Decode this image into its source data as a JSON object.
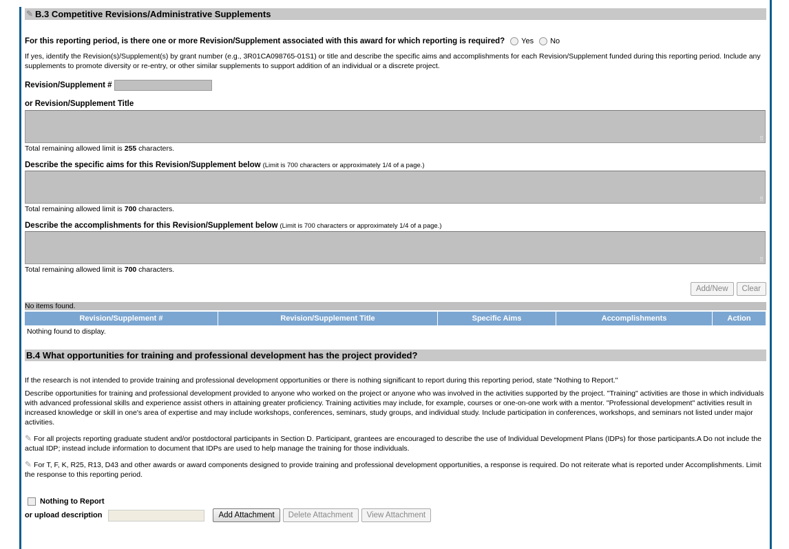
{
  "b3": {
    "title": "B.3 Competitive Revisions/Administrative Supplements",
    "question": "For this reporting period, is there one or more Revision/Supplement associated with this award for which reporting is required?",
    "options": [
      "Yes",
      "No"
    ],
    "instructions": "If yes, identify the Revision(s)/Supplement(s) by grant number (e.g., 3R01CA098765-01S1) or title and describe the specific aims and accomplishments for each Revision/Supplement funded during this reporting period. Include any supplements to promote diversity or re-entry, or other similar supplements to support addition of an individual or a discrete project.",
    "supp_number_label": "Revision/Supplement #",
    "supp_number_value": "",
    "title_label": "or Revision/Supplement Title",
    "title_remaining_prefix": "Total remaining allowed limit is ",
    "title_remaining": "255",
    "remaining_suffix": " characters.",
    "aims_label": "Describe the specific aims for this Revision/Supplement below",
    "aims_note": "(Limit is 700 characters or approximately 1/4 of a page.)",
    "aims_remaining": "700",
    "accomp_label": "Describe the accomplishments for this Revision/Supplement below",
    "accomp_note": "(Limit is 700 characters or approximately 1/4 of a page.)",
    "accomp_remaining": "700",
    "add_new": "Add/New",
    "clear": "Clear",
    "no_items": "No items found.",
    "columns": [
      "Revision/Supplement #",
      "Revision/Supplement Title",
      "Specific Aims",
      "Accomplishments",
      "Action"
    ],
    "empty": "Nothing found to display."
  },
  "b4": {
    "title": "B.4 What opportunities for training and professional development has the project provided?",
    "p1": "If the research is not intended to provide training and professional development opportunities or there is nothing significant to report during this reporting period, state \"Nothing to Report.\"",
    "p2": "Describe opportunities for training and professional development provided to anyone who worked on the project or anyone who was involved in the activities supported by the project. \"Training\" activities are those in which individuals with advanced professional skills and experience assist others in attaining greater proficiency. Training activities may include, for example, courses or one-on-one work with a mentor. \"Professional development\" activities result in increased knowledge or skill in one's area of expertise and may include workshops, conferences, seminars, study groups, and individual study. Include participation in conferences, workshops, and seminars not listed under major activities.",
    "p3": "For all projects reporting graduate student and/or postdoctoral participants in Section D. Participant, grantees are encouraged to describe the use of Individual Development Plans (IDPs) for those participants.A Do not include the actual IDP; instead include information to document that IDPs are used to help manage the training for those individuals.",
    "p4": "For T, F, K, R25, R13, D43 and other awards or award components designed to provide training and professional development opportunities, a response is required. Do not reiterate what is reported under Accomplishments. Limit the response to this reporting period.",
    "nothing_label": "Nothing to Report",
    "upload_label": "or upload description",
    "upload_value": "",
    "add_attachment": "Add Attachment",
    "delete_attachment": "Delete Attachment",
    "view_attachment": "View Attachment"
  }
}
